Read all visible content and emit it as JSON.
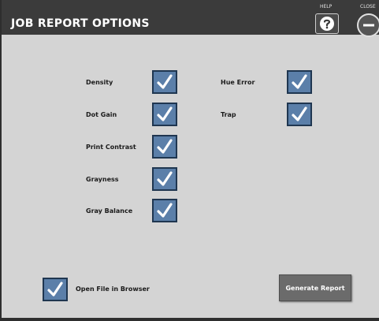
{
  "window": {
    "title": "JOB REPORT OPTIONS",
    "help_caption": "HELP",
    "close_caption": "CLOSE"
  },
  "options_left": [
    {
      "label": "Density",
      "checked": true
    },
    {
      "label": "Dot Gain",
      "checked": true
    },
    {
      "label": "Print Contrast",
      "checked": true
    },
    {
      "label": "Grayness",
      "checked": true
    },
    {
      "label": "Gray Balance",
      "checked": true
    }
  ],
  "options_right": [
    {
      "label": "Hue Error",
      "checked": true
    },
    {
      "label": "Trap",
      "checked": true
    }
  ],
  "open_in_browser": {
    "label": "Open File in Browser",
    "checked": true
  },
  "generate_button": {
    "label": "Generate Report"
  },
  "icons": {
    "help": "help-question-icon",
    "close": "close-minus-icon",
    "check": "checkmark-icon"
  },
  "colors": {
    "titlebar": "#3b3b3b",
    "panel": "#d4d4d4",
    "checkbox_fill": "#5b7fa9",
    "checkbox_border": "#1f3650",
    "button": "#6b6b6b"
  }
}
